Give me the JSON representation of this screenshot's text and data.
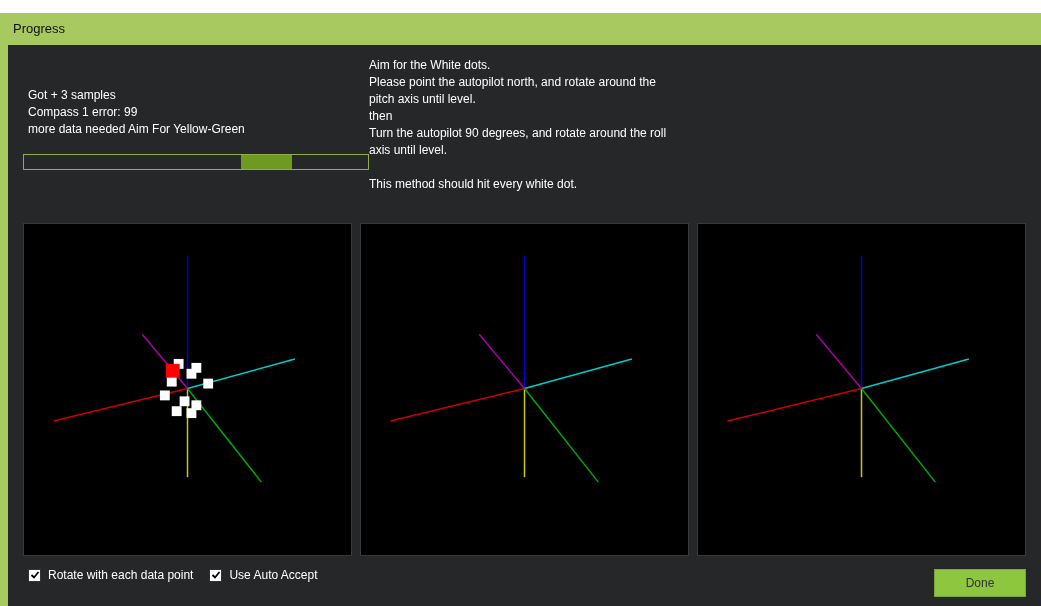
{
  "window": {
    "title": "Progress"
  },
  "status_lines": [
    "Got + 3 samples",
    "Compass 1 error: 99",
    "more data needed Aim For Yellow-Green"
  ],
  "instructions": [
    "Aim for the White dots.",
    "Please point the autopilot north, and rotate around the pitch axis until level.",
    "then",
    "Turn the autopilot 90 degrees, and rotate around the roll axis until level."
  ],
  "note": "This method should hit every white dot.",
  "views": [
    {
      "kind": "samples"
    },
    {
      "kind": "axes"
    },
    {
      "kind": "axes"
    }
  ],
  "options": [
    {
      "label": "Rotate with each data point",
      "checked": true
    },
    {
      "label": "Use Auto Accept",
      "checked": true
    }
  ],
  "done_button": "Done"
}
